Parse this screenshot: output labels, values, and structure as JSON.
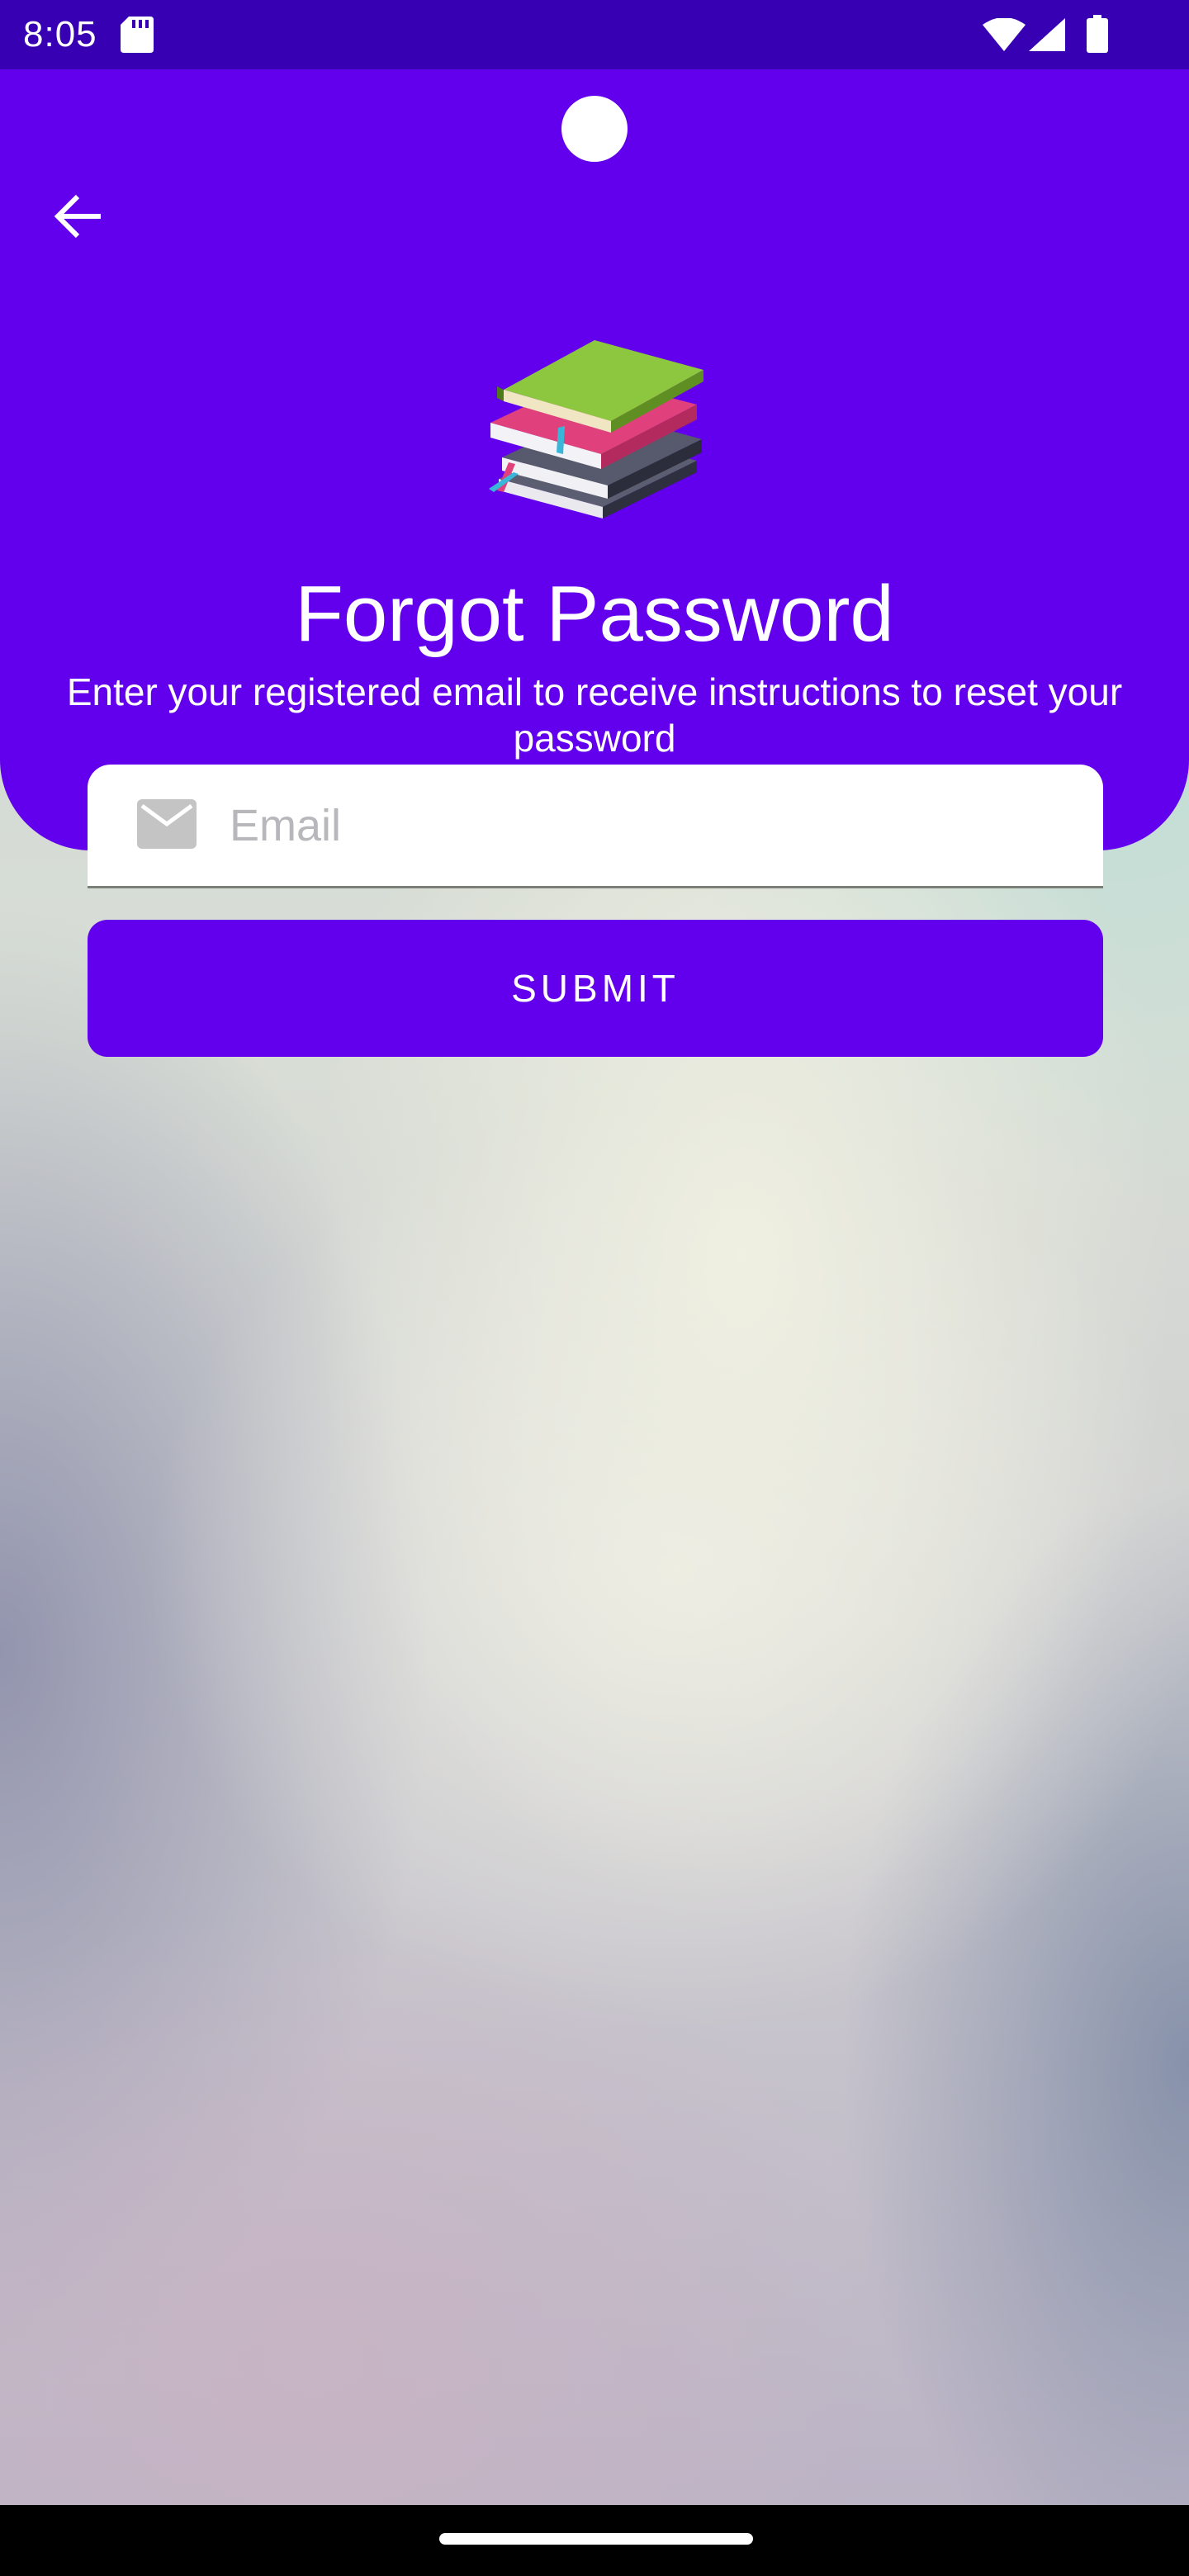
{
  "status_bar": {
    "time": "8:05",
    "icons": [
      "sd-card-icon",
      "wifi-icon",
      "signal-icon",
      "battery-icon"
    ]
  },
  "header": {
    "back_icon": "arrow-left-icon",
    "image": "stacked-books",
    "title": "Forgot Password",
    "subtitle": "Enter your registered email to receive instructions to reset your password"
  },
  "form": {
    "email": {
      "icon": "mail-icon",
      "placeholder": "Email",
      "value": ""
    },
    "submit_label": "SUBMIT"
  },
  "colors": {
    "status_bar": "#3700b3",
    "primary": "#6200ee",
    "field_background": "#ffffff",
    "placeholder": "#b8b8bc",
    "icon_gray": "#c4c4c4"
  }
}
